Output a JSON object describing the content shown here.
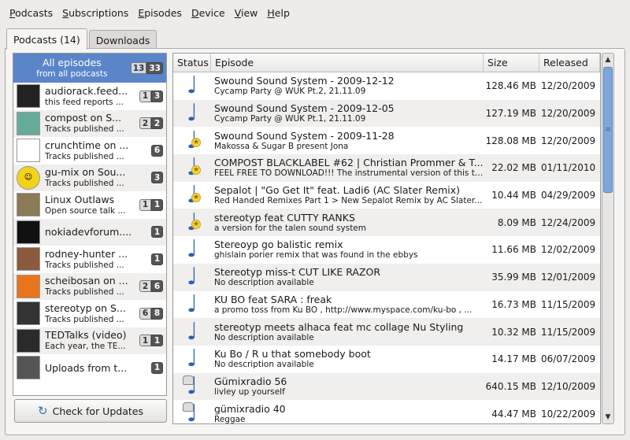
{
  "menubar": [
    {
      "mnemonic": "P",
      "rest": "odcasts"
    },
    {
      "mnemonic": "S",
      "rest": "ubscriptions"
    },
    {
      "mnemonic": "E",
      "rest": "pisodes"
    },
    {
      "mnemonic": "D",
      "rest": "evice"
    },
    {
      "mnemonic": "V",
      "rest": "iew"
    },
    {
      "mnemonic": "H",
      "rest": "elp"
    }
  ],
  "tabs": {
    "podcasts": "Podcasts (14)",
    "downloads": "Downloads"
  },
  "sidebar": [
    {
      "title": "All episodes",
      "sub": "from all podcasts",
      "new": "13",
      "total": "33",
      "thumb": "",
      "selected": true
    },
    {
      "title": "audiorack.feed...",
      "sub": "this feed reports ...",
      "new": "1",
      "total": "3",
      "thumb": "audiorack-icon"
    },
    {
      "title": "compost on S...",
      "sub": "Tracks published ...",
      "new": "2",
      "total": "2",
      "thumb": "compost-icon"
    },
    {
      "title": "crunchtime on ...",
      "sub": "Tracks published ...",
      "new": "",
      "total": "6",
      "thumb": "crunchtime-icon"
    },
    {
      "title": "gu-mix on Sou...",
      "sub": "Tracks published ...",
      "new": "",
      "total": "3",
      "thumb": "smiley-icon"
    },
    {
      "title": "Linux Outlaws",
      "sub": "Open source talk ...",
      "new": "1",
      "total": "1",
      "thumb": "linux-outlaws-icon"
    },
    {
      "title": "nokiadevforum....",
      "sub": "",
      "new": "",
      "total": "1",
      "thumb": "nokia-icon"
    },
    {
      "title": "rodney-hunter ...",
      "sub": "Tracks published ...",
      "new": "",
      "total": "1",
      "thumb": "rodney-icon"
    },
    {
      "title": "scheibosan on ...",
      "sub": "Tracks published ...",
      "new": "2",
      "total": "6",
      "thumb": "scheibosan-icon"
    },
    {
      "title": "stereotyp on S...",
      "sub": "Tracks published ...",
      "new": "6",
      "total": "8",
      "thumb": "stereotyp-icon"
    },
    {
      "title": "TEDTalks (video)",
      "sub": "Each year, the TE...",
      "new": "1",
      "total": "1",
      "thumb": "ted-icon"
    },
    {
      "title": "Uploads from t...",
      "sub": "",
      "new": "",
      "total": "1",
      "thumb": "uploads-icon"
    }
  ],
  "check_updates": "Check for Updates",
  "columns": {
    "status": "Status",
    "episode": "Episode",
    "size": "Size",
    "released": "Released"
  },
  "episodes": [
    {
      "title": "Swound Sound System - 2009-12-12",
      "desc": "Cycamp Party @ WUK Pt.2, 21.11.09",
      "size": "128.46 MB",
      "released": "12/20/2009",
      "badge": ""
    },
    {
      "title": "Swound Sound System - 2009-12-05",
      "desc": "Cycamp Party @ WUK Pt.1, 21.11.09",
      "size": "127.19 MB",
      "released": "12/20/2009",
      "badge": ""
    },
    {
      "title": "Swound Sound System - 2009-11-28",
      "desc": "Makossa & Sugar B present Jona",
      "size": "128.08 MB",
      "released": "12/20/2009",
      "badge": "new"
    },
    {
      "title": "COMPOST BLACKLABEL #62 | Christian Prommer & T...",
      "desc": "FEEL FREE TO DOWNLOAD!!! The instrumental version of this tr...",
      "size": "22.02 MB",
      "released": "01/11/2010",
      "badge": "new"
    },
    {
      "title": "Sepalot | \"Go Get It\" feat. Ladi6 (AC Slater Remix)",
      "desc": "Red Handed Remixes Part 1 > New Sepalot Remix by AC Slater...",
      "size": "10.44 MB",
      "released": "04/29/2009",
      "badge": "new"
    },
    {
      "title": "stereotyp feat CUTTY RANKS",
      "desc": "a version for the talen sound system",
      "size": "8.09 MB",
      "released": "12/24/2009",
      "badge": "new"
    },
    {
      "title": "Stereoyp go balistic remix",
      "desc": "ghislain porier remix that was found in the ebbys",
      "size": "11.66 MB",
      "released": "12/02/2009",
      "badge": ""
    },
    {
      "title": "Stereotyp miss-t CUT LIKE RAZOR",
      "desc": "No description available",
      "size": "35.99 MB",
      "released": "12/01/2009",
      "badge": ""
    },
    {
      "title": " KU BO feat SARA :  freak",
      "desc": "a promo toss from Ku BO ,   http://www.myspace.com/ku-bo , ...",
      "size": "16.73 MB",
      "released": "11/15/2009",
      "badge": ""
    },
    {
      "title": "stereotyp meets alhaca feat mc collage Nu Styling",
      "desc": "No description available",
      "size": "10.32 MB",
      "released": "11/15/2009",
      "badge": ""
    },
    {
      "title": "Ku Bo  /  R u that somebody boot",
      "desc": "No description available",
      "size": "14.17 MB",
      "released": "06/07/2009",
      "badge": ""
    },
    {
      "title": "Gümixradio 56",
      "desc": "livley up yourself",
      "size": "640.15 MB",
      "released": "12/10/2009",
      "badge": "lock"
    },
    {
      "title": "gümixradio 40",
      "desc": "Reggae",
      "size": "44.47 MB",
      "released": "10/22/2009",
      "badge": "lock"
    }
  ]
}
